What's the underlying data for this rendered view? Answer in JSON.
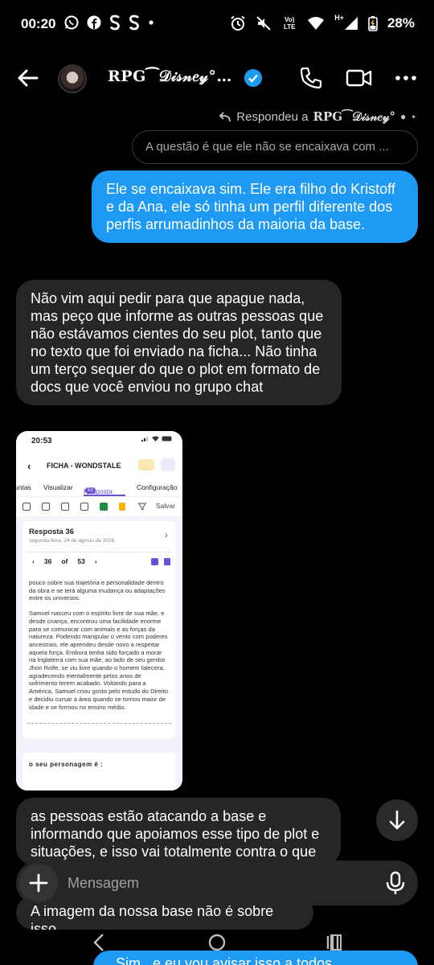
{
  "status_bar": {
    "time": "00:20",
    "left_icons": [
      "whatsapp-icon",
      "facebook-icon",
      "s-app-icon",
      "s-app-icon",
      "dot-icon"
    ],
    "network_label": "Vo) LTE",
    "signal_label": "H+",
    "battery": "28%"
  },
  "header": {
    "title": "RPG⁀𝒟𝒾𝓈𝓃𝑒𝓎°…",
    "verified": true
  },
  "reply": {
    "prefix": "Respondeu a",
    "name": "RPG⁀𝒟𝒾𝓈𝓃𝑒𝓎° ",
    "quoted_text": "A questão é que ele não se encaixava com ..."
  },
  "messages": {
    "outgoing_1": "Ele se encaixava sim. Ele era filho do Kristoff e da Ana, ele só tinha um perfil diferente dos perfis arrumadinhos da maioria da base.",
    "incoming_1": "Não vim aqui pedir para que apague nada, mas peço que informe as outras pessoas que não estávamos cientes do seu plot, tanto que no texto que foi enviado na ficha... Não tinha um terço sequer do que o plot em formato de docs que você enviou no grupo chat",
    "incoming_2": "as pessoas estão atacando a base e informando que apoiamos esse tipo de plot e situações, e isso vai totalmente contra o que se",
    "incoming_3": "A imagem da nossa base não é sobre isso",
    "outgoing_peek": "Sim...e eu vou avisar isso a todos"
  },
  "shared_screenshot": {
    "time": "20:53",
    "title": "FICHA - WONDSTALE",
    "tabs": [
      "untas",
      "Visualizar",
      "Resposta",
      "Configuração"
    ],
    "tab_badge": "53",
    "save_label": "Salvar",
    "response_title": "Resposta 36",
    "response_date": "segunda-feira, 24 de agosto de 2026",
    "pager_current": "36",
    "pager_of": "of",
    "pager_total": "53",
    "paragraph_1": "pouco sobre sua trajetória e personalidade dentro da obra e se terá alguma mudança ou adaptações entre os universos.",
    "paragraph_2": "Samuel nasceu com o espírito livre de sua mãe, e desde criança, encontrou uma facilidade enorme para se comunicar com animais e as forças da natureza. Podendo manipular o vento com poderes ancestrais, ele aprendeu desde novo a respeitar aquela força. Embora tenha sido forçado a morar na Inglaterra com sua mãe, ao lado de seu genitor Jhon Rolfe, se viu livre quando o homem falecera, agradecendo mentalmente pelos anos de sofrimento terem acabado. Voltando para a América, Samuel criou gosto pelo estudo do Direito e decidiu cursar a área quando se tornou maior de idade e se formou no ensino médio.",
    "question": "o seu personagem é :"
  },
  "composer": {
    "placeholder": "Mensagem"
  },
  "colors": {
    "outgoing_bubble": "#1e9af5",
    "incoming_bubble": "#262626",
    "background": "#000000",
    "accent_purple": "#6b4fd8"
  }
}
